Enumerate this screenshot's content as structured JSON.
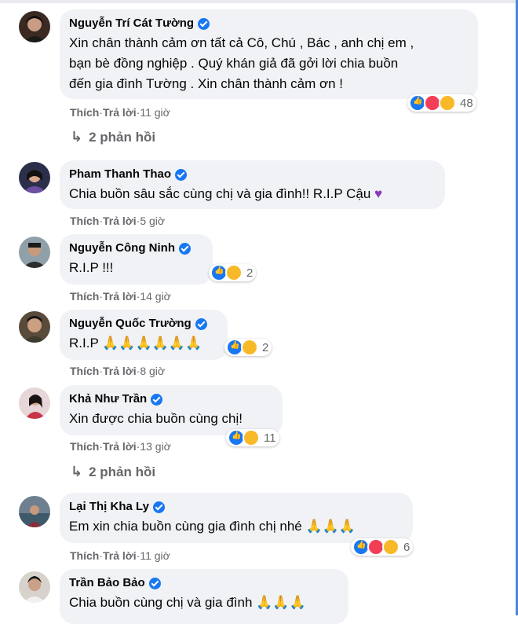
{
  "comments": [
    {
      "name": "Nguyễn Trí Cát Tường",
      "text": "Xin chân thành cảm ơn tất cả Cô, Chú , Bác , anh chị em ,\nbạn bè đồng nghiệp . Quý khán giả đã gởi lời chia buồn\nđến gia đình Tường . Xin chân thành cảm ơn !",
      "like": "Thích",
      "reply": "Trả lời",
      "time": "11 giờ",
      "reaction_count": "48",
      "replies_label": "2 phản hồi"
    },
    {
      "name": "Pham Thanh Thao",
      "text": "Chia buồn sâu sắc cùng chị và gia đình!! R.I.P Cậu",
      "like": "Thích",
      "reply": "Trả lời",
      "time": "5 giờ"
    },
    {
      "name": "Nguyễn Công Ninh",
      "text": "R.I.P !!!",
      "like": "Thích",
      "reply": "Trả lời",
      "time": "14 giờ",
      "reaction_count": "2"
    },
    {
      "name": "Nguyễn Quốc Trường",
      "text": "R.I.P",
      "like": "Thích",
      "reply": "Trả lời",
      "time": "8 giờ",
      "reaction_count": "2"
    },
    {
      "name": "Khả Như Trần",
      "text": "Xin được chia buồn cùng chị!",
      "like": "Thích",
      "reply": "Trả lời",
      "time": "13 giờ",
      "reaction_count": "11",
      "replies_label": "2 phản hồi"
    },
    {
      "name": "Lại Thị Kha Ly",
      "text": "Em xin chia buồn cùng gia đình chị nhé",
      "like": "Thích",
      "reply": "Trả lời",
      "time": "11 giờ",
      "reaction_count": "6"
    },
    {
      "name": "Trần Bảo Bảo",
      "text": "Chia buồn cùng chị và gia đình"
    }
  ],
  "separator": " · ",
  "icons": {
    "verified": "verified-badge-icon",
    "pray": "folded-hands-emoji",
    "heart": "purple-heart-emoji",
    "reply": "reply-arrow-icon"
  },
  "colors": {
    "bubble": "#f0f2f5",
    "meta": "#65676b",
    "verified": "#1877f2",
    "like": "#1877f2",
    "love": "#f33e58",
    "sad": "#f7b928"
  }
}
